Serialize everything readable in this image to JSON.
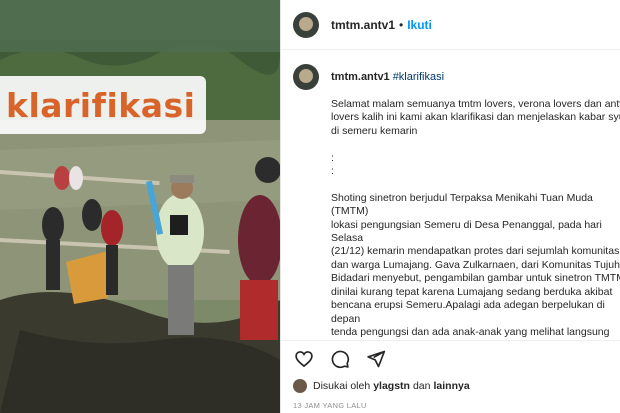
{
  "post": {
    "overlay_text": "klarifikasi"
  },
  "header": {
    "username": "tmtm.antv1",
    "separator": "•",
    "follow_label": "Ikuti"
  },
  "comment": {
    "username": "tmtm.antv1",
    "hashtag": "#klarifikasi",
    "body": "Selamat malam semuanya tmtm lovers, verona lovers dan antv\nlovers kalih ini kami akan klarifikasi dan menjelaskan kabar syut\ndi semeru kemarin\n\n:\n:\n\nShoting sinetron berjudul Terpaksa Menikahi Tuan Muda (TMTM)\nlokasi pengungsian Semeru di Desa Penanggal, pada hari Selasa\n(21/12) kemarin mendapatkan protes dari sejumlah komunitas\ndan warga Lumajang. Gava Zulkarnaen, dari Komunitas Tujuh\nBidadari menyebut, pengambilan gambar untuk sinetron TMTM\ndinilai kurang tepat karena Lumajang sedang berduka akibat\nbencana erupsi Semeru.Apalagi ada adegan berpelukan di depan\ntenda pengungsi dan ada anak-anak yang melihat langsung\nadegan itu. Kami menganggap ini kurang pantas,\" kata Gava\nZulkarnaen, kepada Jatimtimes.\nBahkan terkait protes ini, Gava Zulkarnaen menyerukan boikot"
  },
  "actions": {
    "like_icon": "heart-icon",
    "comment_icon": "comment-icon",
    "share_icon": "send-icon"
  },
  "likes": {
    "prefix": "Disukai oleh",
    "user": "ylagstn",
    "conjunction": "dan",
    "others": "lainnya"
  },
  "timestamp": "13 JAM YANG LALU"
}
